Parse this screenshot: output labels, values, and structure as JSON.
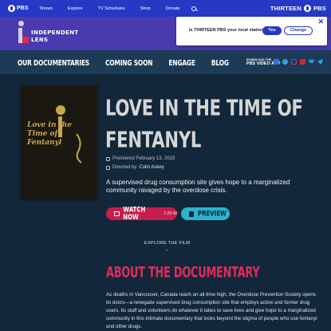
{
  "pbs_bar": {
    "logo": "PBS",
    "nav": [
      "Shows",
      "Explore",
      "TV Schedules",
      "Shop",
      "Donate"
    ],
    "station": "THIRTEEN",
    "station_logo": "PBS",
    "colors": {
      "bg": "#2638c4"
    }
  },
  "show": {
    "logo_lines": [
      "INDEPENDENT",
      "LENS"
    ],
    "colors": {
      "header_bg": "#4a3ab0",
      "accent": "#e0294f"
    }
  },
  "popup": {
    "question": "Is THIRTEEN PBS your local station?",
    "yes_label": "Yes",
    "change_label": "Change",
    "close_glyph": "✕"
  },
  "show_nav": {
    "items": [
      "OUR DOCUMENTARIES",
      "COMING SOON",
      "ENGAGE",
      "BLOG"
    ],
    "app_small": "DOWNLOAD THE",
    "app_big": "PBS VIDEO APP",
    "social_icons": [
      "facebook-icon",
      "twitter-icon",
      "instagram-icon",
      "youtube-icon",
      "cart-icon",
      "telegram-icon"
    ]
  },
  "film": {
    "poster_title_lines": [
      "Love in the",
      "Time of",
      "Fentanyl"
    ],
    "title": "LOVE IN THE TIME OF FENTANYL",
    "premiered": "Premiered February 13, 2023",
    "directed_prefix": "Directed by",
    "director": "Colin Askey",
    "description": "A supervised drug consumption site gives hope to a marginalized community ravaged by the overdose crisis.",
    "watch_label": "WATCH NOW",
    "watch_duration": "1:25:48",
    "preview_label": "PREVIEW"
  },
  "explore": {
    "label": "EXPLORE THE FILM",
    "chevron": "⌄"
  },
  "about": {
    "heading": "ABOUT THE DOCUMENTARY",
    "body": "As deaths in Vancouver, Canada reach an all-time high, the Overdose Prevention Society opens its doors—a renegade supervised drug consumption site that employs active and former drug users. Its staff and volunteers do whatever it takes to save lives and give hope to a marginalized community in this intimate documentary that looks beyond the stigma of people who use fentanyl and other drugs."
  }
}
